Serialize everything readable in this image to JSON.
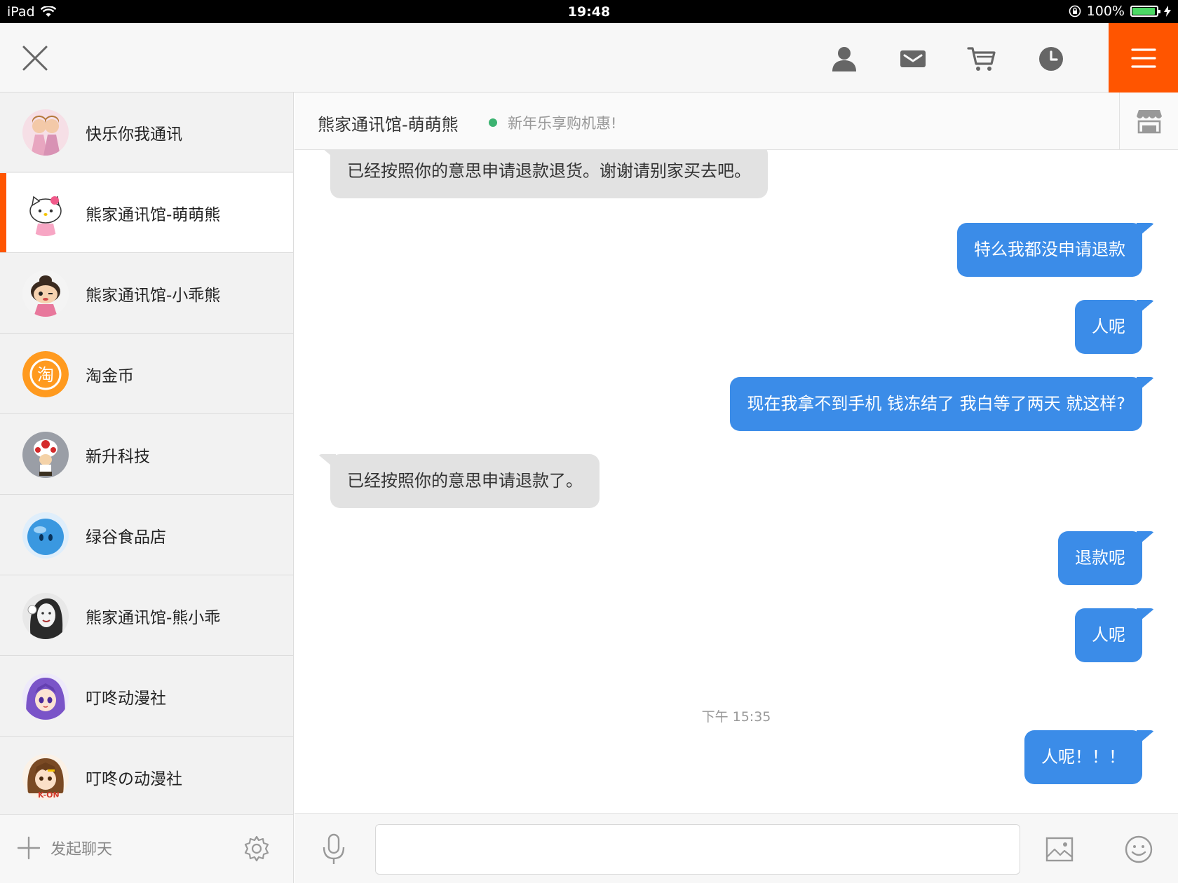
{
  "status_bar": {
    "device": "iPad",
    "time": "19:48",
    "battery": "100%"
  },
  "colors": {
    "accent": "#ff5500",
    "bubble_out": "#3b8ce8",
    "bubble_in": "#e2e2e2",
    "online": "#3cb371"
  },
  "icons": {
    "close": "close-icon",
    "profile": "user-icon",
    "messages": "envelope-icon",
    "cart": "cart-icon",
    "history": "clock-icon",
    "menu": "hamburger-icon",
    "shop": "store-icon",
    "settings": "gear-icon",
    "mic": "microphone-icon",
    "image": "image-icon",
    "emoji": "smiley-icon"
  },
  "contacts": [
    {
      "name": "快乐你我通讯",
      "avatar": "twin-dolls-avatar"
    },
    {
      "name": "熊家通讯馆-萌萌熊",
      "avatar": "hello-kitty-avatar"
    },
    {
      "name": "熊家通讯馆-小乖熊",
      "avatar": "cartoon-girl-avatar"
    },
    {
      "name": "淘金币",
      "avatar": "taobao-coin-avatar",
      "glyph": "淘"
    },
    {
      "name": "新升科技",
      "avatar": "mushroom-toad-avatar"
    },
    {
      "name": "绿谷食品店",
      "avatar": "blue-droplet-avatar"
    },
    {
      "name": "熊家通讯馆-熊小乖",
      "avatar": "woman-photo-avatar"
    },
    {
      "name": "叮咚动漫社",
      "avatar": "anime-purple-hair-avatar"
    },
    {
      "name": "叮咚の动漫社",
      "avatar": "k-on-anime-avatar",
      "badge_text": "K-ON"
    }
  ],
  "sidebar_footer": {
    "new_chat_label": "发起聊天"
  },
  "chat": {
    "title": "熊家通讯馆-萌萌熊",
    "slogan": "新年乐享购机惠!",
    "messages": [
      {
        "dir": "in",
        "text": "已经按照你的意思申请退款退货。谢谢请别家买去吧。"
      },
      {
        "dir": "out",
        "text": "特么我都没申请退款"
      },
      {
        "dir": "out",
        "text": "人呢"
      },
      {
        "dir": "out",
        "text": "现在我拿不到手机 钱冻结了 我白等了两天 就这样?"
      },
      {
        "dir": "in",
        "text": "已经按照你的意思申请退款了。"
      },
      {
        "dir": "out",
        "text": "退款呢"
      },
      {
        "dir": "out",
        "text": "人呢"
      },
      {
        "dir": "out",
        "text": "人呢！！！"
      }
    ],
    "timestamp": "下午 15:35"
  },
  "input": {
    "value": "",
    "placeholder": ""
  }
}
